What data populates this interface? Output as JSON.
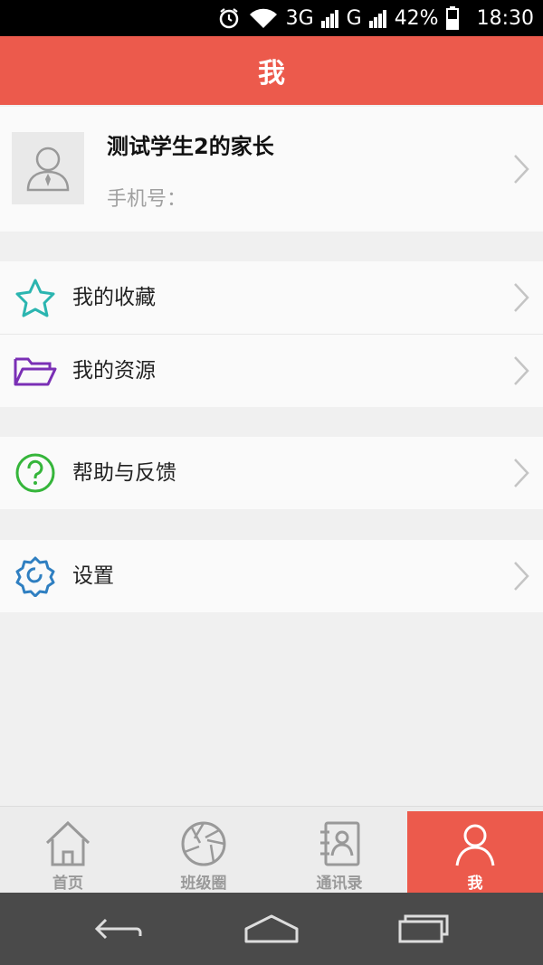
{
  "status_bar": {
    "network1": "3G",
    "network2": "G",
    "battery": "42%",
    "time": "18:30",
    "icons": [
      "alarm-icon",
      "wifi-icon",
      "signal-icon",
      "battery-icon"
    ]
  },
  "header": {
    "title": "我"
  },
  "profile": {
    "name": "测试学生2的家长",
    "phone_label": "手机号："
  },
  "menu": {
    "favorites": "我的收藏",
    "resources": "我的资源",
    "help": "帮助与反馈",
    "settings": "设置"
  },
  "tabs": [
    {
      "label": "首页",
      "icon": "home-icon"
    },
    {
      "label": "班级圈",
      "icon": "aperture-icon"
    },
    {
      "label": "通讯录",
      "icon": "contacts-icon"
    },
    {
      "label": "我",
      "icon": "person-icon"
    }
  ],
  "active_tab": "我",
  "colors": {
    "accent": "#ec5a4c",
    "star": "#2bb5b0",
    "folder": "#7a2fb5",
    "help": "#35b53a",
    "settings": "#2f7fc1"
  }
}
